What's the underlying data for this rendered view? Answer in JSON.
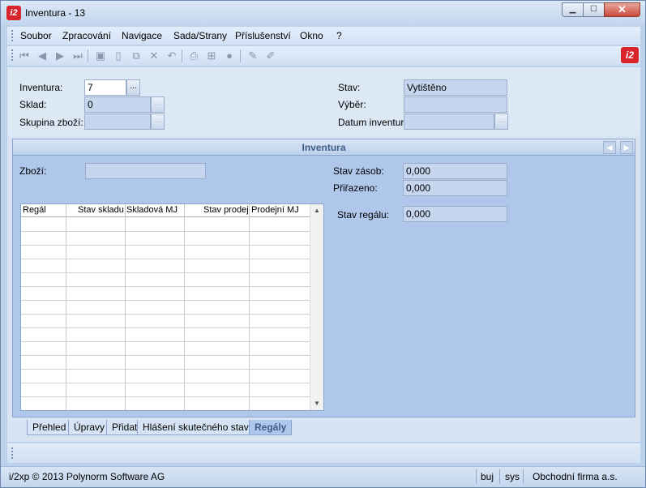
{
  "window": {
    "logo": "i2",
    "title": "Inventura - 13",
    "buttons": {
      "minimize": "▁",
      "maximize": "☐",
      "close": "✕"
    }
  },
  "menu": {
    "items": [
      "Soubor",
      "Zpracování",
      "Navigace",
      "Sada/Strany",
      "Příslušenství",
      "Okno",
      "?"
    ]
  },
  "toolbar": {
    "icons": [
      "first-record-icon",
      "previous-record-icon",
      "next-record-icon",
      "last-record-icon",
      "save-icon",
      "new-icon",
      "copy-icon",
      "delete-icon",
      "undo-icon",
      "print-icon",
      "tree-icon",
      "disc-icon",
      "edit-icon",
      "edit-disabled-icon"
    ],
    "logo": "i2"
  },
  "form": {
    "inventura_label": "Inventura:",
    "inventura_value": "7",
    "sklad_label": "Sklad:",
    "sklad_value": "0",
    "skupina_label": "Skupina zboží:",
    "skupina_value": "",
    "stav_label": "Stav:",
    "stav_value": "Vytištěno",
    "vyber_label": "Výběr:",
    "vyber_value": "",
    "datum_label": "Datum inventury:",
    "datum_value": "",
    "lookup_button": "..."
  },
  "section": {
    "title": "Inventura",
    "zbozi_label": "Zboží:",
    "zbozi_value": "",
    "stav_zasob_label": "Stav zásob:",
    "stav_zasob_value": "0,000",
    "prirazeno_label": "Přiřazeno:",
    "prirazeno_value": "0,000",
    "stav_regalu_label": "Stav regálu:",
    "stav_regalu_value": "0,000"
  },
  "grid": {
    "columns": [
      "Regál",
      "Stav skladu",
      "Skladová MJ",
      "Stav prodej",
      "Prodejní MJ"
    ],
    "rows": []
  },
  "tabs": {
    "items": [
      "Přehled",
      "Úpravy",
      "Přidat",
      "Hlášení skutečného stavu",
      "Regály"
    ],
    "active": "Regály"
  },
  "status": {
    "copyright": "i/2xp © 2013 Polynorm Software AG",
    "user": "buj",
    "system": "sys",
    "company": "Obchodní firma a.s."
  }
}
